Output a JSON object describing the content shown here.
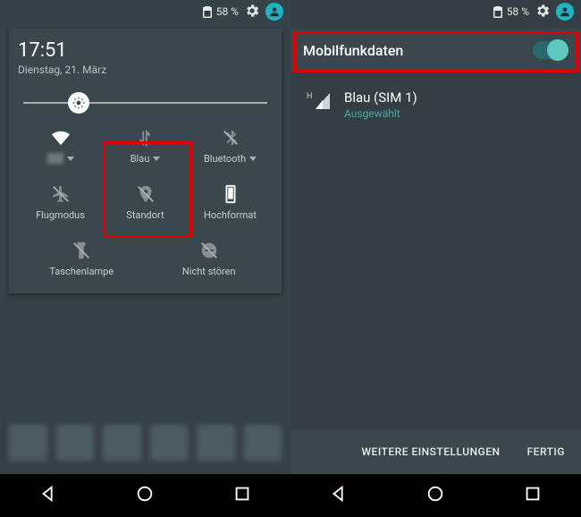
{
  "status": {
    "battery_pct": "58 %"
  },
  "left": {
    "clock": "17:51",
    "date": "Dienstag, 21. März",
    "tiles": {
      "wifi": "",
      "mobile": "Blau",
      "bluetooth": "Bluetooth",
      "airplane": "Flugmodus",
      "location": "Standort",
      "portrait": "Hochformat",
      "flashlight": "Taschenlampe",
      "dnd": "Nicht stören"
    }
  },
  "right": {
    "title": "Mobilfunkdaten",
    "sim_name": "Blau (SIM 1)",
    "sim_status": "Ausgewählt",
    "more": "WEITERE EINSTELLUNGEN",
    "done": "FERTIG"
  }
}
